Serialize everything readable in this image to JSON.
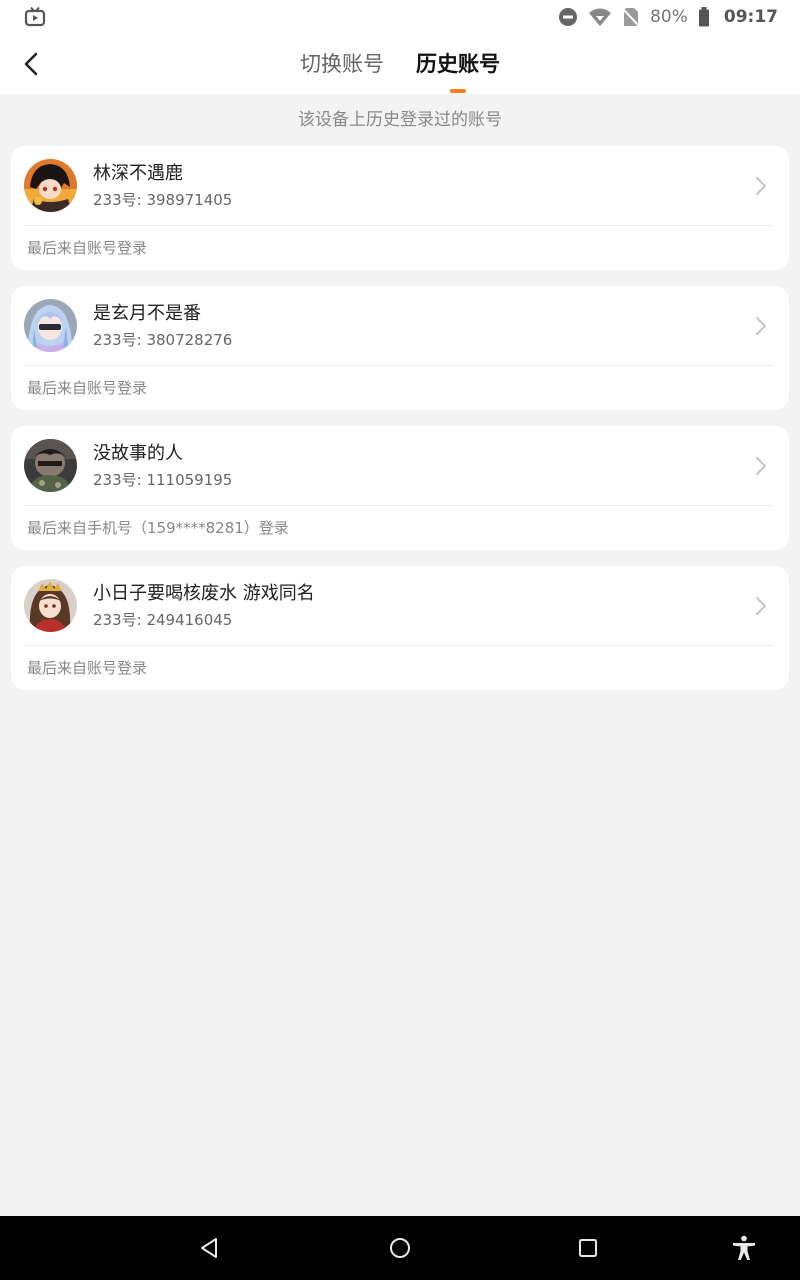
{
  "status_bar": {
    "battery_percent": "80%",
    "time": "09:17",
    "icons": [
      "tv-app-icon",
      "dnd-icon",
      "wifi-icon",
      "no-sim-icon",
      "battery-icon"
    ]
  },
  "header": {
    "tabs": [
      {
        "label": "切换账号",
        "active": false
      },
      {
        "label": "历史账号",
        "active": true
      }
    ],
    "accent_color": "#ff7a1a"
  },
  "subtitle": "该设备上历史登录过的账号",
  "accounts": [
    {
      "name": "林深不遇鹿",
      "id_text": "233号: 398971405",
      "last_login": "最后来自账号登录"
    },
    {
      "name": "是玄月不是番",
      "id_text": "233号: 380728276",
      "last_login": "最后来自账号登录"
    },
    {
      "name": "没故事的人",
      "id_text": "233号: 111059195",
      "last_login": "最后来自手机号（159****8281）登录"
    },
    {
      "name": "小日子要喝核废水 游戏同名",
      "id_text": "233号: 249416045",
      "last_login": "最后来自账号登录"
    }
  ],
  "nav_bar": {
    "buttons": [
      "back-triangle-icon",
      "home-circle-icon",
      "recents-square-icon",
      "accessibility-icon"
    ]
  }
}
